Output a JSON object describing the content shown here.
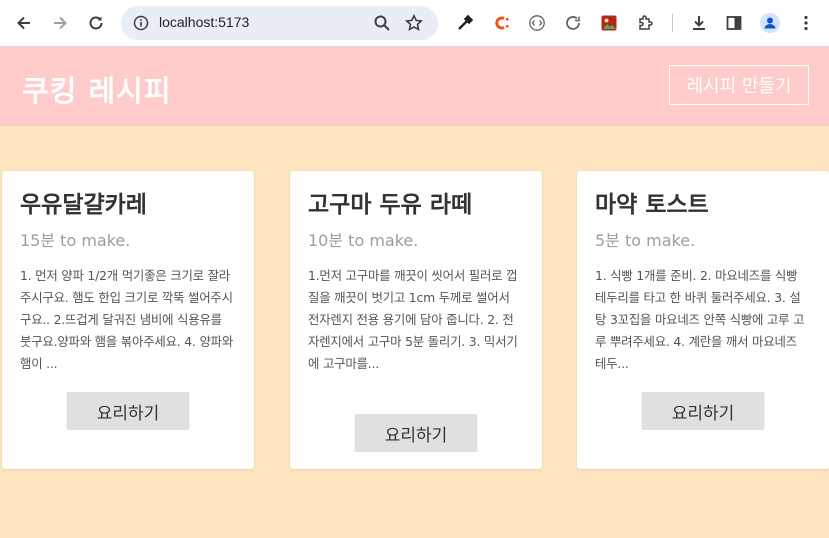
{
  "browser": {
    "url": "localhost:5173",
    "icons": {
      "back": "arrow-left-icon",
      "forward": "arrow-right-icon",
      "reload": "reload-icon",
      "site_info": "site-info-icon",
      "zoom": "zoom-icon",
      "bookmark": "star-icon",
      "extensions": [
        "eyedropper-icon",
        "c-extension-icon",
        "code-extension-icon",
        "refresh-extension-icon",
        "image-extension-icon",
        "puzzle-icon"
      ],
      "download": "download-icon",
      "side_panel": "side-panel-icon",
      "profile": "profile-icon",
      "menu": "kebab-menu-icon"
    }
  },
  "header": {
    "title": "쿠킹 레시피",
    "create_button": "레시피 만들기",
    "colors": {
      "background": "#ffcccb",
      "text": "#ffffff"
    }
  },
  "page": {
    "background": "#fde6bf"
  },
  "recipes": [
    {
      "title": "우유달걀카레",
      "time": "15분 to make.",
      "description": "1. 먼저 양파 1/2개 먹기좋은 크기로 잘라주시구요. 햄도 한입 크기로 깍뚝 썰어주시구요.. 2.뜨겁게 달궈진 냄비에 식용유를 붓구요.양파와 햄을 볶아주세요. 4. 양파와 햄이 ...",
      "button": "요리하기"
    },
    {
      "title": "고구마 두유 라떼",
      "time": "10분 to make.",
      "description": "1.먼저 고구마를 깨끗이 씻어서 필러로 껍질을 깨끗이 벗기고 1cm 두께로 썰어서 전자렌지 전용 용기에 담아 줍니다. 2. 전자렌지에서 고구마 5분 돌리기. 3. 믹서기에 고구마를...",
      "button": "요리하기"
    },
    {
      "title": "마약 토스트",
      "time": "5분 to make.",
      "description": "1. 식빵 1개를 준비. 2. 마요네즈를 식빵 테두리를 타고 한 바퀴 둘러주세요. 3. 설탕 3꼬집을 마요네즈 안쪽 식빵에 고루 고루 뿌려주세요. 4. 계란을 깨서 마요네즈 테두...",
      "button": "요리하기"
    }
  ]
}
